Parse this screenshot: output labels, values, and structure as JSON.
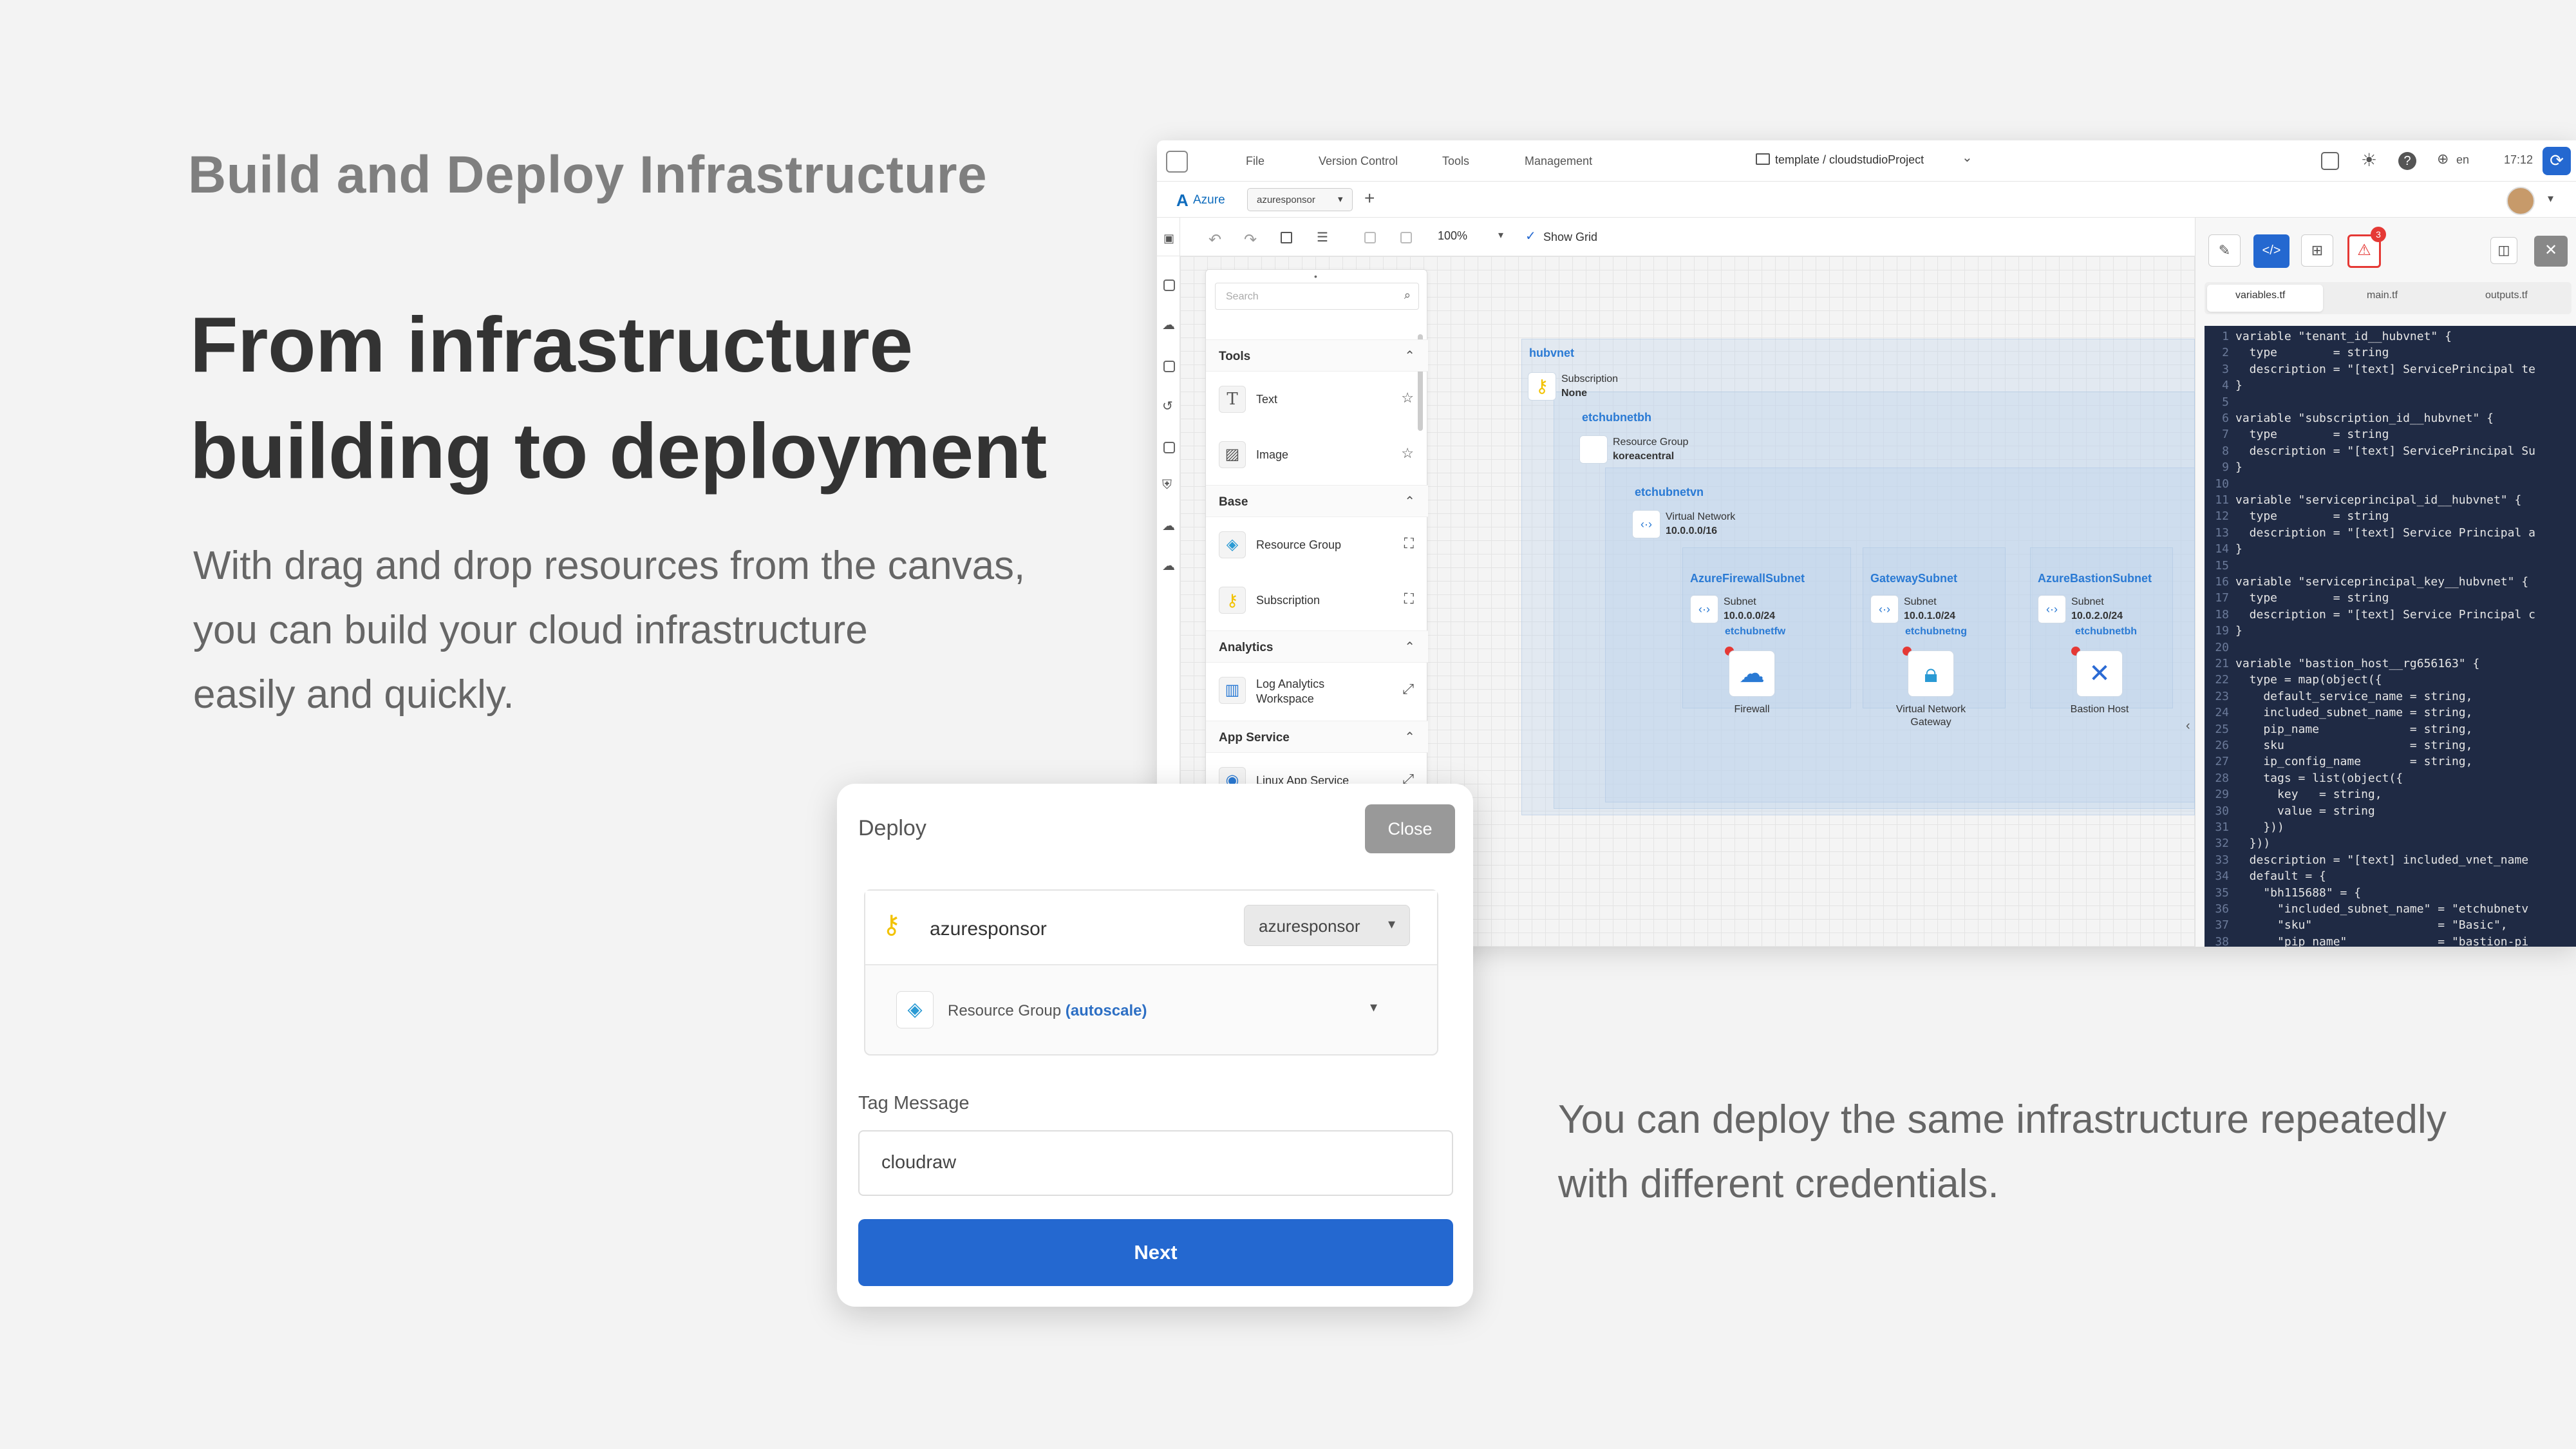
{
  "hero": {
    "eyebrow": "Build and Deploy Infrastructure",
    "title_line1": "From infrastructure",
    "title_line2": "building to deployment",
    "para_line1": "With drag and drop resources from the canvas,",
    "para_line2": "you can build your cloud infrastructure",
    "para_line3": "easily and quickly.",
    "right_line1": "You can deploy the same infrastructure repeatedly",
    "right_line2": "with different credentials."
  },
  "menubar": {
    "items": [
      "File",
      "Version Control",
      "Tools",
      "Management"
    ],
    "path": "template / cloudstudioProject",
    "lang": "en",
    "time": "17:12"
  },
  "tabbar": {
    "provider": "Azure",
    "account": "azuresponsor",
    "add": "+"
  },
  "toolbar": {
    "zoom": "100%",
    "show_grid": "Show Grid"
  },
  "palette": {
    "search_placeholder": "Search",
    "sections": [
      {
        "name": "Tools",
        "items": [
          "Text",
          "Image"
        ]
      },
      {
        "name": "Base",
        "items": [
          "Resource Group",
          "Subscription"
        ]
      },
      {
        "name": "Analytics",
        "items": [
          "Log Analytics Workspace"
        ]
      },
      {
        "name": "App Service",
        "items": [
          "Linux App Service"
        ]
      }
    ]
  },
  "diagram": {
    "hubvnet": "hubvnet",
    "subscription_type": "Subscription",
    "subscription_name": "None",
    "rg_label": "etchubnetbh",
    "rg_type": "Resource Group",
    "rg_region": "koreacentral",
    "vn_label": "etchubnetvn",
    "vn_type": "Virtual Network",
    "vn_cidr": "10.0.0.0/16",
    "subnets": [
      {
        "zone": "AzureFirewallSubnet",
        "type": "Subnet",
        "cidr": "10.0.0.0/24",
        "res_label": "etchubnetfw",
        "res_name": "Firewall"
      },
      {
        "zone": "GatewaySubnet",
        "type": "Subnet",
        "cidr": "10.0.1.0/24",
        "res_label": "etchubnetng",
        "res_name": "Virtual Network Gateway"
      },
      {
        "zone": "AzureBastionSubnet",
        "type": "Subnet",
        "cidr": "10.0.2.0/24",
        "res_label": "etchubnetbh",
        "res_name": "Bastion Host"
      }
    ]
  },
  "panel": {
    "badge": "3",
    "tabs": [
      "variables.tf",
      "main.tf",
      "outputs.tf"
    ],
    "code": [
      "variable \"tenant_id__hubvnet\" {",
      "  type        = string",
      "  description = \"[text] ServicePrincipal te",
      "}",
      "",
      "variable \"subscription_id__hubvnet\" {",
      "  type        = string",
      "  description = \"[text] ServicePrincipal Su",
      "}",
      "",
      "variable \"serviceprincipal_id__hubvnet\" {",
      "  type        = string",
      "  description = \"[text] Service Principal a",
      "}",
      "",
      "variable \"serviceprincipal_key__hubvnet\" {",
      "  type        = string",
      "  description = \"[text] Service Principal c",
      "}",
      "",
      "variable \"bastion_host__rg656163\" {",
      "  type = map(object({",
      "    default_service_name = string,",
      "    included_subnet_name = string,",
      "    pip_name             = string,",
      "    sku                  = string,",
      "    ip_config_name       = string,",
      "    tags = list(object({",
      "      key   = string,",
      "      value = string",
      "    }))",
      "  }))",
      "  description = \"[text] included_vnet_name",
      "  default = {",
      "    \"bh115688\" = {",
      "      \"included_subnet_name\" = \"etchubnetv",
      "      \"sku\"                  = \"Basic\",",
      "      \"pip_name\"             = \"bastion-pi"
    ]
  },
  "deploy": {
    "title": "Deploy",
    "close": "Close",
    "account": "azuresponsor",
    "account_select": "azuresponsor",
    "rg_label": "Resource Group",
    "rg_mode": "(autoscale)",
    "tag_label": "Tag Message",
    "tag_value": "cloudraw",
    "next": "Next"
  },
  "colors": {
    "accent": "#2468d0",
    "zone_label": "#2a7ad4",
    "code_bg": "#1f2a44",
    "alert": "#e53935"
  }
}
